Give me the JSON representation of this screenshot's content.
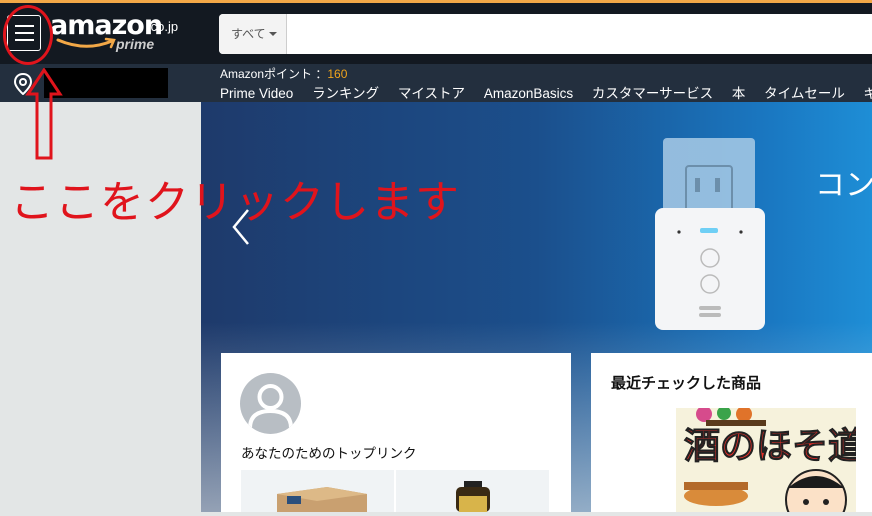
{
  "header": {
    "logo_text": "amazon",
    "logo_tld": ".co.jp",
    "logo_sub": "prime",
    "search_dept": "すべて",
    "search_placeholder": ""
  },
  "subnav": {
    "points_label": "Amazonポイント ：",
    "points_value": "160",
    "links": [
      "Prime Video",
      "ランキング",
      "マイストア",
      "AmazonBasics",
      "カスタマーサービス",
      "本",
      "タイムセール",
      "ギ"
    ]
  },
  "hero": {
    "text": "コン"
  },
  "cards": {
    "top_links_title": "あなたのためのトップリンク",
    "recent_title": "最近チェックした商品",
    "book_title": "酒のほそ道"
  },
  "annotation": {
    "text": "ここをクリックします"
  },
  "colors": {
    "header_bg": "#131921",
    "subnav_bg": "#232f3e",
    "accent_orange": "#f0a31c",
    "annotation_red": "#e0141c"
  }
}
